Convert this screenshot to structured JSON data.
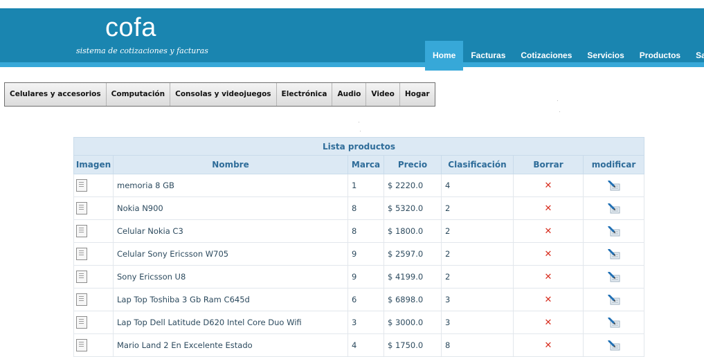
{
  "app": {
    "logo": "cofa",
    "tagline": "sistema de cotizaciones y facturas"
  },
  "nav": {
    "items": [
      {
        "label": "Home",
        "active": true
      },
      {
        "label": "Facturas",
        "active": false
      },
      {
        "label": "Cotizaciones",
        "active": false
      },
      {
        "label": "Servicios",
        "active": false
      },
      {
        "label": "Productos",
        "active": false
      },
      {
        "label": "Salir",
        "active": false
      }
    ]
  },
  "categories": [
    "Celulares y accesorios",
    "Computación",
    "Consolas y videojuegos",
    "Electrónica",
    "Audio",
    "Video",
    "Hogar"
  ],
  "table": {
    "caption": "Lista productos",
    "headers": [
      "Imagen",
      "Nombre",
      "Marca",
      "Precio",
      "Clasificación",
      "Borrar",
      "modificar"
    ],
    "rows": [
      {
        "nombre": "memoria 8 GB",
        "marca": "1",
        "precio": "$ 2220.0",
        "clasificacion": "4"
      },
      {
        "nombre": "Nokia N900",
        "marca": "8",
        "precio": "$ 5320.0",
        "clasificacion": "2"
      },
      {
        "nombre": "Celular Nokia C3",
        "marca": "8",
        "precio": "$ 1800.0",
        "clasificacion": "2"
      },
      {
        "nombre": "Celular Sony Ericsson W705",
        "marca": "9",
        "precio": "$ 2597.0",
        "clasificacion": "2"
      },
      {
        "nombre": "Sony Ericsson U8",
        "marca": "9",
        "precio": "$ 4199.0",
        "clasificacion": "2"
      },
      {
        "nombre": "Lap Top Toshiba 3 Gb Ram C645d",
        "marca": "6",
        "precio": "$ 6898.0",
        "clasificacion": "3"
      },
      {
        "nombre": "Lap Top Dell Latitude D620 Intel Core Duo Wifi",
        "marca": "3",
        "precio": "$ 3000.0",
        "clasificacion": "3"
      },
      {
        "nombre": "Mario Land 2 En Excelente Estado",
        "marca": "4",
        "precio": "$ 1750.0",
        "clasificacion": "8"
      }
    ],
    "delete_symbol": "✕"
  },
  "colors": {
    "header": "#1a85b0",
    "header_accent": "#37a8d8",
    "table_header": "#dce9f4",
    "delete": "#d72d1e"
  },
  "icons": {
    "image": "image-placeholder-icon",
    "delete": "delete-x-icon",
    "edit": "edit-pencil-icon"
  }
}
